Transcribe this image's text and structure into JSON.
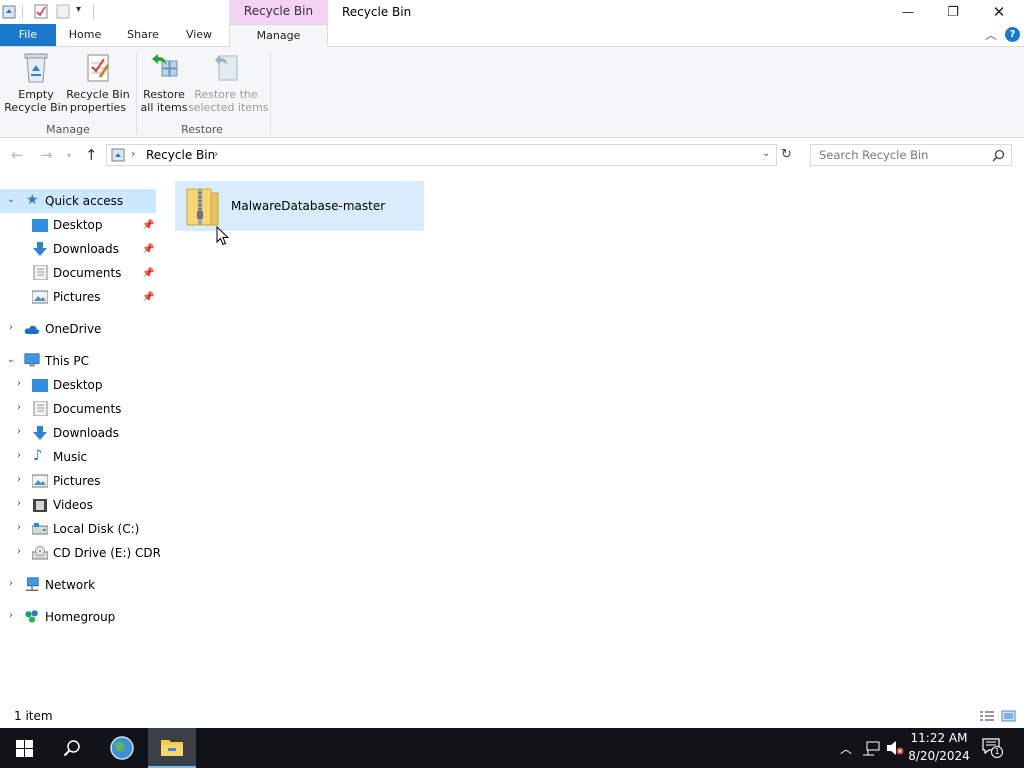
{
  "window": {
    "title": "Recycle Bin",
    "contextual_tab_group": "Recycle Bin Tools",
    "minimize_glyph": "—",
    "restore_glyph": "❐",
    "close_glyph": "✕"
  },
  "ribbon_tabs": {
    "file": "File",
    "home": "Home",
    "share": "Share",
    "view": "View",
    "manage": "Manage"
  },
  "ribbon": {
    "empty_recycle_bin": "Empty\nRecycle Bin",
    "recycle_bin_properties": "Recycle Bin\nproperties",
    "restore_all_items": "Restore\nall items",
    "restore_selected_items": "Restore the\nselected items",
    "group_manage": "Manage",
    "group_restore": "Restore"
  },
  "address": {
    "location": "Recycle Bin",
    "search_placeholder": "Search Recycle Bin"
  },
  "nav": {
    "quick_access": "Quick access",
    "qa_desktop": "Desktop",
    "qa_downloads": "Downloads",
    "qa_documents": "Documents",
    "qa_pictures": "Pictures",
    "onedrive": "OneDrive",
    "this_pc": "This PC",
    "pc_desktop": "Desktop",
    "pc_documents": "Documents",
    "pc_downloads": "Downloads",
    "pc_music": "Music",
    "pc_pictures": "Pictures",
    "pc_videos": "Videos",
    "local_disk": "Local Disk (C:)",
    "cd_drive": "CD Drive (E:) CDROI",
    "network": "Network",
    "homegroup": "Homegroup"
  },
  "content": {
    "items": [
      {
        "name": "MalwareDatabase-master",
        "icon": "zip-folder-icon"
      }
    ]
  },
  "status": {
    "item_count": "1 item"
  },
  "taskbar": {
    "time": "11:22 AM",
    "date": "8/20/2024",
    "notification_count": "1"
  },
  "colors": {
    "accent": "#1979ca",
    "selection": "#cce8ff",
    "contextual_tab": "#f4d3f2",
    "taskbar": "#101418"
  }
}
